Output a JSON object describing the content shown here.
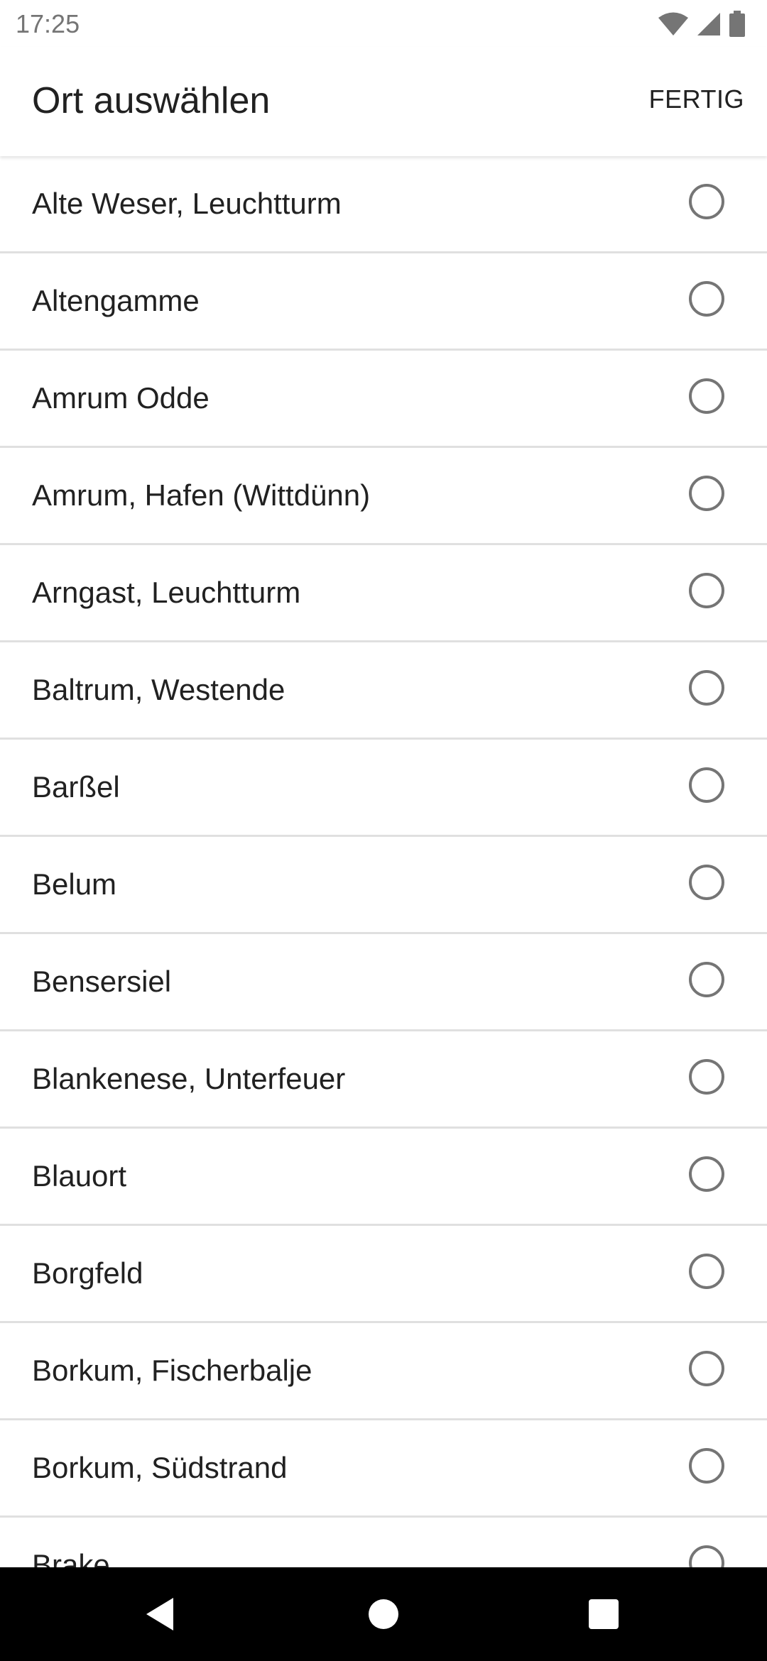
{
  "status_bar": {
    "time": "17:25",
    "icons": [
      "wifi-icon",
      "signal-icon",
      "battery-icon"
    ]
  },
  "app_bar": {
    "title": "Ort auswählen",
    "done_label": "FERTIG"
  },
  "locations": [
    {
      "label": "Alte Weser, Leuchtturm",
      "selected": false
    },
    {
      "label": "Altengamme",
      "selected": false
    },
    {
      "label": "Amrum Odde",
      "selected": false
    },
    {
      "label": "Amrum, Hafen (Wittdünn)",
      "selected": false
    },
    {
      "label": "Arngast, Leuchtturm",
      "selected": false
    },
    {
      "label": "Baltrum, Westende",
      "selected": false
    },
    {
      "label": "Barßel",
      "selected": false
    },
    {
      "label": "Belum",
      "selected": false
    },
    {
      "label": "Bensersiel",
      "selected": false
    },
    {
      "label": "Blankenese, Unterfeuer",
      "selected": false
    },
    {
      "label": "Blauort",
      "selected": false
    },
    {
      "label": "Borgfeld",
      "selected": false
    },
    {
      "label": "Borkum, Fischerbalje",
      "selected": false
    },
    {
      "label": "Borkum, Südstrand",
      "selected": false
    },
    {
      "label": "Brake",
      "selected": false
    }
  ],
  "nav_bar": {
    "buttons": [
      "back-icon",
      "home-icon",
      "recents-icon"
    ]
  },
  "colors": {
    "text_primary": "#212121",
    "text_secondary": "#757575",
    "divider": "#e0e0e0",
    "radio_border": "#757575",
    "nav_background": "#000000",
    "nav_icon": "#ffffff"
  }
}
